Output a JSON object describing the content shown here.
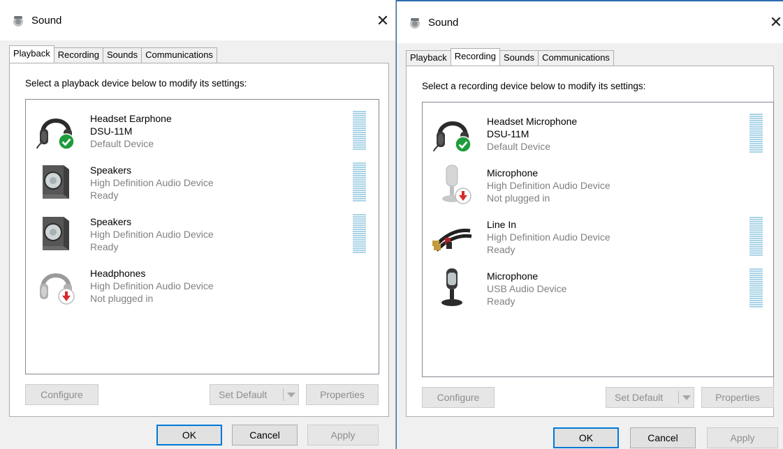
{
  "left_dialog": {
    "title": "Sound",
    "close_glyph": "✕",
    "tabs": [
      {
        "label": "Playback",
        "active": true
      },
      {
        "label": "Recording",
        "active": false
      },
      {
        "label": "Sounds",
        "active": false
      },
      {
        "label": "Communications",
        "active": false
      }
    ],
    "instruction": "Select a playback device below to modify its settings:",
    "devices": [
      {
        "icon": "headset-icon",
        "status_icon": "default-check-icon",
        "name": "Headset Earphone",
        "line2": "DSU-11M",
        "line3": "Default Device",
        "meter": true
      },
      {
        "icon": "speaker-icon",
        "name": "Speakers",
        "line2": "High Definition Audio Device",
        "line3": "Ready",
        "meter": true
      },
      {
        "icon": "speaker-icon",
        "name": "Speakers",
        "line2": "High Definition Audio Device",
        "line3": "Ready",
        "meter": true
      },
      {
        "icon": "headphones-icon",
        "status_icon": "unplugged-arrow-icon",
        "name": "Headphones",
        "line2": "High Definition Audio Device",
        "line3": "Not plugged in",
        "meter": false
      }
    ],
    "buttons": {
      "configure": "Configure",
      "set_default": "Set Default",
      "properties": "Properties"
    },
    "footer": {
      "ok": "OK",
      "cancel": "Cancel",
      "apply": "Apply"
    }
  },
  "right_dialog": {
    "title": "Sound",
    "close_glyph": "✕",
    "tabs": [
      {
        "label": "Playback",
        "active": false
      },
      {
        "label": "Recording",
        "active": true
      },
      {
        "label": "Sounds",
        "active": false
      },
      {
        "label": "Communications",
        "active": false
      }
    ],
    "instruction": "Select a recording device below to modify its settings:",
    "devices": [
      {
        "icon": "headset-mic-icon",
        "status_icon": "default-check-icon",
        "name": "Headset Microphone",
        "line2": "DSU-11M",
        "line3": "Default Device",
        "meter": true
      },
      {
        "icon": "microphone-icon",
        "status_icon": "unplugged-arrow-icon",
        "name": "Microphone",
        "line2": "High Definition Audio Device",
        "line3": "Not plugged in",
        "meter": false
      },
      {
        "icon": "line-in-cable-icon",
        "name": "Line In",
        "line2": "High Definition Audio Device",
        "line3": "Ready",
        "meter": true
      },
      {
        "icon": "usb-microphone-icon",
        "name": "Microphone",
        "line2": "USB Audio Device",
        "line3": "Ready",
        "meter": true
      }
    ],
    "buttons": {
      "configure": "Configure",
      "set_default": "Set Default",
      "properties": "Properties"
    },
    "footer": {
      "ok": "OK",
      "cancel": "Cancel",
      "apply": "Apply"
    }
  },
  "colors": {
    "accent": "#0078d7",
    "check_green": "#1e9c3c",
    "unplugged_red": "#d92b2b",
    "meter": "#a9d3e6"
  }
}
